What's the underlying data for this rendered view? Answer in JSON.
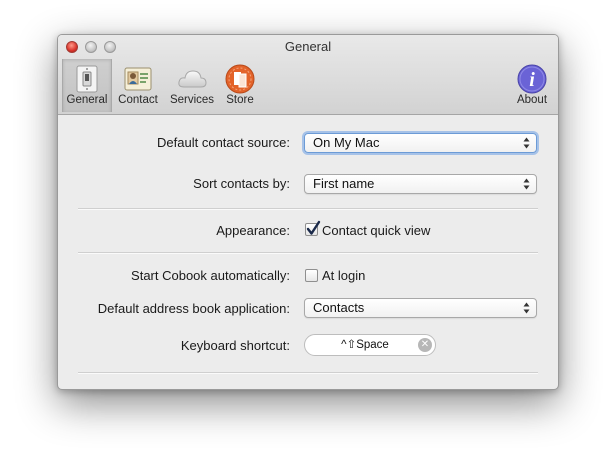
{
  "window": {
    "title": "General"
  },
  "toolbar": {
    "items": [
      {
        "label": "General",
        "icon": "light-switch-icon",
        "selected": true
      },
      {
        "label": "Contact",
        "icon": "contact-card-icon",
        "selected": false
      },
      {
        "label": "Services",
        "icon": "cloud-icon",
        "selected": false
      },
      {
        "label": "Store",
        "icon": "store-badge-icon",
        "selected": false
      },
      {
        "label": "About",
        "icon": "info-icon",
        "selected": false
      }
    ]
  },
  "form": {
    "default_contact_source": {
      "label": "Default contact source:",
      "value": "On My Mac"
    },
    "sort_contacts_by": {
      "label": "Sort contacts by:",
      "value": "First name"
    },
    "appearance": {
      "label": "Appearance:",
      "option": "Contact quick view",
      "checked": true
    },
    "start_automatically": {
      "label": "Start Cobook automatically:",
      "option": "At login",
      "checked": false
    },
    "default_address_book": {
      "label": "Default address book application:",
      "value": "Contacts"
    },
    "keyboard_shortcut": {
      "label": "Keyboard shortcut:",
      "value": "^⇧Space"
    }
  },
  "colors": {
    "store_accent": "#e3632a",
    "about_accent": "#6a63d6",
    "focus_ring": "#6c9bd6"
  }
}
